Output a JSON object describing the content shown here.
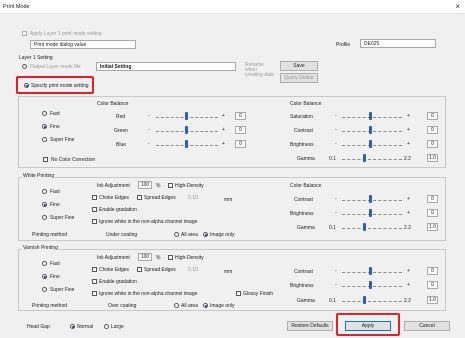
{
  "window": {
    "title": "Print Mode",
    "close_glyph": "×"
  },
  "top": {
    "apply_layer1_label": "Apply Layer 1 print mode setting",
    "dialog_value": "Print mode dialog value",
    "profile_label": "Profile",
    "profile_value": "DE025"
  },
  "layer1": {
    "section_label": "Layer 1 Setting",
    "output_mode_label": "Output Layer mode file",
    "initial_setting_value": "Initial Setting",
    "hint_text": "Rename when creating data",
    "save_label": "Save",
    "query_delete_label": "Query Delete",
    "specify_label": "Specify print mode setting"
  },
  "quality": {
    "fast": "Fast",
    "fine": "Fine",
    "super_fine": "Super Fine",
    "selected": "Fine"
  },
  "color_balance_left": {
    "title": "Color Balance",
    "rows": [
      {
        "label": "Red",
        "value": "0"
      },
      {
        "label": "Green",
        "value": "0"
      },
      {
        "label": "Blue",
        "value": "0"
      }
    ],
    "minus": "-",
    "plus": "+"
  },
  "color_balance_right": {
    "title": "Color Balance",
    "rows": [
      {
        "label": "Saturation",
        "value": "0"
      },
      {
        "label": "Contrast",
        "value": "0"
      },
      {
        "label": "Brightness",
        "value": "0"
      }
    ],
    "gamma_label": "Gamma",
    "gamma_min": "0.1",
    "gamma_max": "2.2",
    "gamma_value": "1.0"
  },
  "no_color_correction": "No Color Correction",
  "white": {
    "title": "White Printing",
    "ink_adjustment_label": "Ink Adjustment",
    "ink_value": "100",
    "percent": "%",
    "high_density": "High-Density",
    "choke_edges": "Choke Edges",
    "spread_edges": "Spread Edges",
    "edge_value": "0.10",
    "edge_unit": "mm",
    "enable_gradation": "Enable gradation",
    "ignore_white": "Ignore white in the non-alpha channel image",
    "printing_method_label": "Printing method",
    "coating_label": "Under coating",
    "all_area": "All area",
    "image_only": "Image only",
    "color_balance_title": "Color Balance",
    "rows": [
      {
        "label": "Contrast",
        "value": "0"
      },
      {
        "label": "Brightness",
        "value": "0"
      }
    ],
    "gamma_label": "Gamma",
    "gamma_min": "0.1",
    "gamma_max": "2.2",
    "gamma_value": "1.0"
  },
  "varnish": {
    "title": "Varnish Printing",
    "ink_adjustment_label": "Ink Adjustment",
    "ink_value": "100",
    "percent": "%",
    "high_density": "High-Density",
    "choke_edges": "Choke Edges",
    "spread_edges": "Spread Edges",
    "edge_value": "0.10",
    "edge_unit": "mm",
    "enable_gradation": "Enable gradation",
    "ignore_white": "Ignore white in the non-alpha channel image",
    "glossy_finish": "Glossy Finish",
    "printing_method_label": "Printing method",
    "coating_label": "Over coating",
    "all_area": "All area",
    "image_only": "Image only",
    "rows": [
      {
        "label": "Contrast",
        "value": "0"
      },
      {
        "label": "Brightness",
        "value": "0"
      }
    ],
    "gamma_label": "Gamma",
    "gamma_min": "0.1",
    "gamma_max": "2.2",
    "gamma_value": "1.0"
  },
  "footer": {
    "head_gap_label": "Head Gap",
    "normal": "Normal",
    "large": "Large",
    "restore_defaults": "Restore Defaults",
    "apply": "Apply",
    "cancel": "Cancel"
  },
  "colors": {
    "highlight": "#e5202a",
    "slider_thumb": "#2e5fb8",
    "window_bg": "#f0f0f0"
  }
}
